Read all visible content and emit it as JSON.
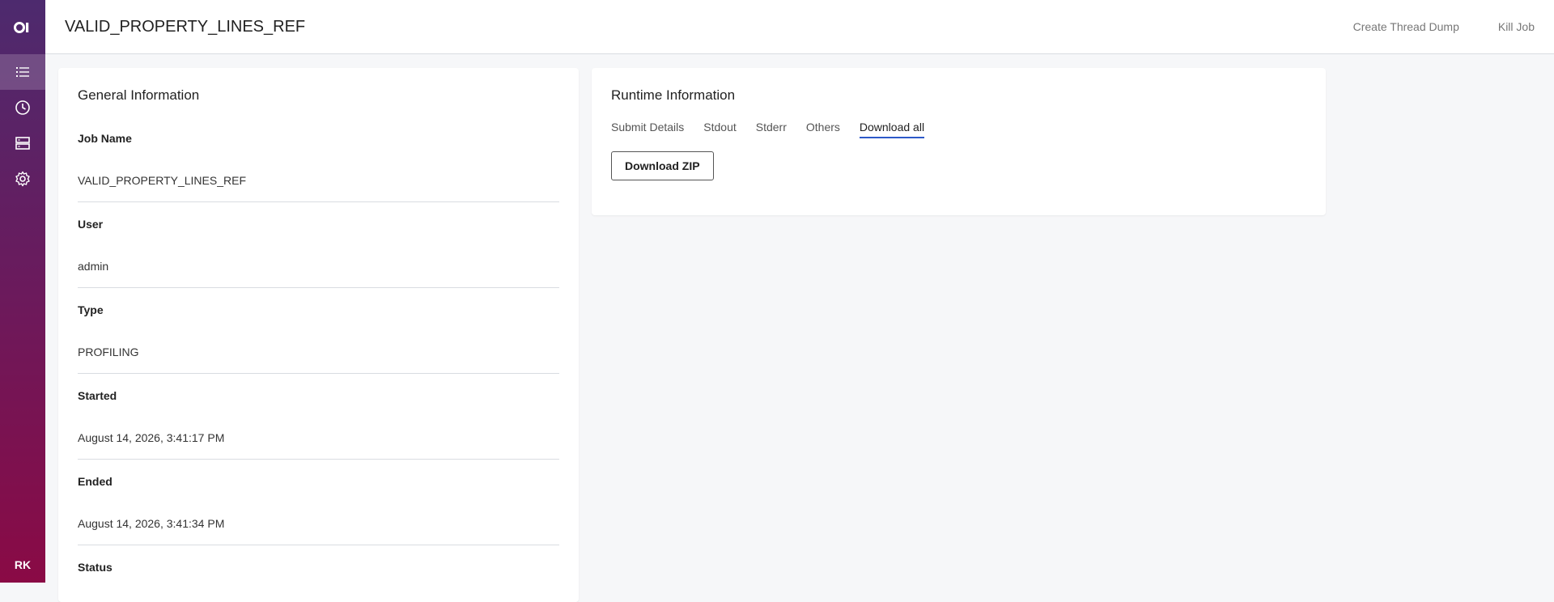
{
  "app": {
    "logo_text": "OI",
    "avatar_initials": "RK"
  },
  "sidebar": {
    "items": [
      {
        "icon": "list-icon",
        "active": true
      },
      {
        "icon": "clock-icon",
        "active": false
      },
      {
        "icon": "server-icon",
        "active": false
      },
      {
        "icon": "gear-icon",
        "active": false
      }
    ]
  },
  "header": {
    "title": "VALID_PROPERTY_LINES_REF",
    "actions": [
      "Create Thread Dump",
      "Kill Job"
    ]
  },
  "general": {
    "title": "General Information",
    "fields": [
      {
        "label": "Job Name",
        "value": "VALID_PROPERTY_LINES_REF"
      },
      {
        "label": "User",
        "value": "admin"
      },
      {
        "label": "Type",
        "value": "PROFILING"
      },
      {
        "label": "Started",
        "value": "August 14, 2026, 3:41:17 PM"
      },
      {
        "label": "Ended",
        "value": "August 14, 2026, 3:41:34 PM"
      },
      {
        "label": "Status",
        "value": ""
      }
    ]
  },
  "runtime": {
    "title": "Runtime Information",
    "tabs": [
      "Submit Details",
      "Stdout",
      "Stderr",
      "Others",
      "Download all"
    ],
    "active_tab": "Download all",
    "download_button": "Download ZIP"
  },
  "colors": {
    "accent": "#2d59c9",
    "sidebar_top": "#4d2a6e",
    "sidebar_bottom": "#8a0a45"
  }
}
